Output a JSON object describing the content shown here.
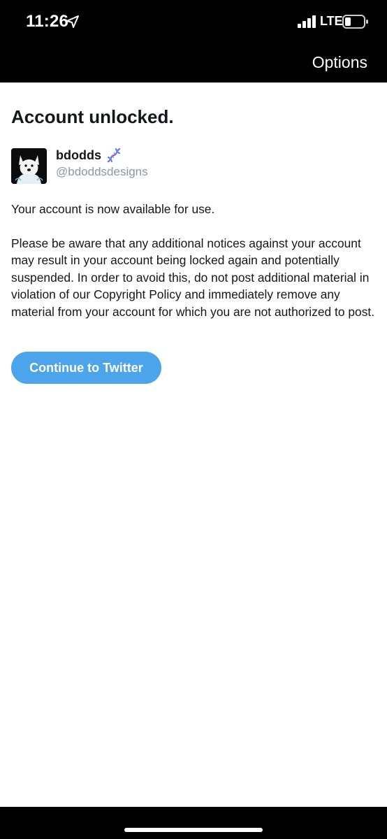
{
  "status_bar": {
    "time": "11:26",
    "network": "LTE",
    "location_icon": "location-arrow-icon",
    "signal_icon": "cellular-signal-icon",
    "battery_icon": "battery-low-icon"
  },
  "nav": {
    "options_label": "Options"
  },
  "page": {
    "title": "Account unlocked."
  },
  "user": {
    "display_name": "bdodds",
    "name_emoji_icon": "dna-icon",
    "handle": "@bdoddsdesigns",
    "avatar_icon": "white-dog-avatar"
  },
  "body": {
    "paragraph_1": "Your account is now available for use.",
    "paragraph_2": "Please be aware that any additional notices against your account may result in your account being locked again and potentially suspended. In order to avoid this, do not post additional material in violation of our Copyright Policy and immediately remove any material from your account for which you are not authorized to post."
  },
  "actions": {
    "continue_label": "Continue to Twitter"
  },
  "colors": {
    "accent": "#4ca4ea",
    "text": "#14171a",
    "secondary_text": "#8899a6"
  }
}
